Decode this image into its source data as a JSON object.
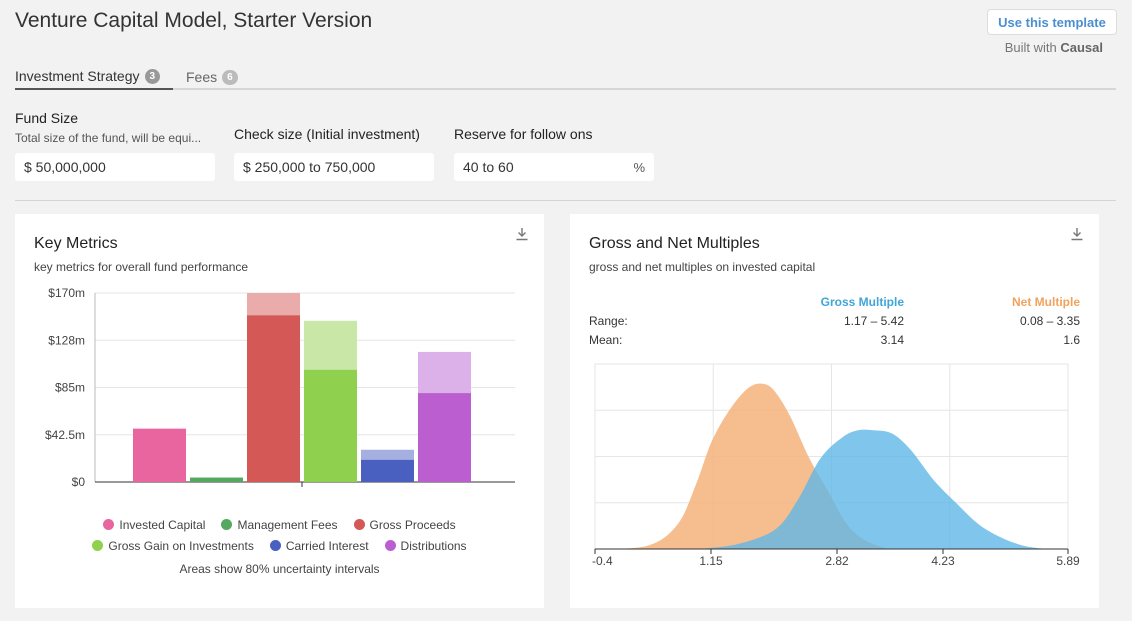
{
  "header": {
    "title": "Venture Capital Model, Starter Version",
    "use_template": "Use this template",
    "built_with": "Built with",
    "built_brand": "Causal"
  },
  "tabs": [
    {
      "label": "Investment Strategy",
      "count": "3",
      "active": true
    },
    {
      "label": "Fees",
      "count": "6",
      "active": false
    }
  ],
  "inputs": {
    "fund_size": {
      "label": "Fund Size",
      "desc": "Total size of the fund, will be equi...",
      "value": "$ 50,000,000"
    },
    "check_size": {
      "label": "Check size (Initial investment)",
      "value": "$ 250,000 to 750,000"
    },
    "reserve": {
      "label": "Reserve for follow ons",
      "value": "40 to 60",
      "suffix": "%"
    }
  },
  "key_metrics": {
    "title": "Key Metrics",
    "subtitle": "key metrics for overall fund performance",
    "note": "Areas show 80% uncertainty intervals",
    "chart_data": {
      "type": "bar",
      "yticks": [
        "$170m",
        "$128m",
        "$85m",
        "$42.5m",
        "$0"
      ],
      "ylim": [
        0,
        170
      ],
      "series": [
        {
          "name": "Invested Capital",
          "value": 48,
          "upper": 48,
          "color": "#e8659f",
          "light": "#f2a9c8"
        },
        {
          "name": "Management Fees",
          "value": 4,
          "upper": 4,
          "color": "#55a860",
          "light": "#9fd0a6"
        },
        {
          "name": "Gross Proceeds",
          "value": 150,
          "upper": 170,
          "color": "#d35856",
          "light": "#e9acaa"
        },
        {
          "name": "Gross Gain on Investments",
          "value": 101,
          "upper": 145,
          "color": "#8fd04e",
          "light": "#c9e8a8"
        },
        {
          "name": "Carried Interest",
          "value": 20,
          "upper": 29,
          "color": "#4a60c0",
          "light": "#a5afe0"
        },
        {
          "name": "Distributions",
          "value": 80,
          "upper": 117,
          "color": "#bb5fd0",
          "light": "#dcb0e8"
        }
      ]
    }
  },
  "multiples": {
    "title": "Gross and Net Multiples",
    "subtitle": "gross and net multiples on invested capital",
    "headers": {
      "gross": "Gross Multiple",
      "net": "Net Multiple"
    },
    "range_label": "Range:",
    "mean_label": "Mean:",
    "gross_range": "1.17 – 5.42",
    "net_range": "0.08 – 3.35",
    "gross_mean": "3.14",
    "net_mean": "1.6",
    "chart_data": {
      "type": "area",
      "xticks": [
        "-0.4",
        "1.15",
        "2.82",
        "4.23",
        "5.89"
      ],
      "xlim": [
        -0.4,
        5.89
      ],
      "series": [
        {
          "name": "Net Multiple",
          "color": "#f5b27a",
          "x": [
            -0.4,
            0.3,
            0.7,
            0.95,
            1.15,
            1.4,
            1.65,
            1.85,
            2.0,
            2.2,
            2.45,
            2.7,
            2.95,
            3.2,
            3.5
          ],
          "y": [
            0,
            0.02,
            0.15,
            0.4,
            0.65,
            0.85,
            0.98,
            1.0,
            0.95,
            0.8,
            0.55,
            0.35,
            0.15,
            0.05,
            0
          ]
        },
        {
          "name": "Gross Multiple",
          "color": "#60b6e6",
          "x": [
            1.0,
            1.5,
            2.0,
            2.3,
            2.6,
            2.9,
            3.1,
            3.3,
            3.55,
            3.8,
            4.1,
            4.4,
            4.7,
            5.0,
            5.3,
            5.6
          ],
          "y": [
            0,
            0.03,
            0.12,
            0.3,
            0.55,
            0.68,
            0.72,
            0.72,
            0.7,
            0.6,
            0.42,
            0.28,
            0.15,
            0.07,
            0.02,
            0
          ]
        }
      ]
    }
  }
}
